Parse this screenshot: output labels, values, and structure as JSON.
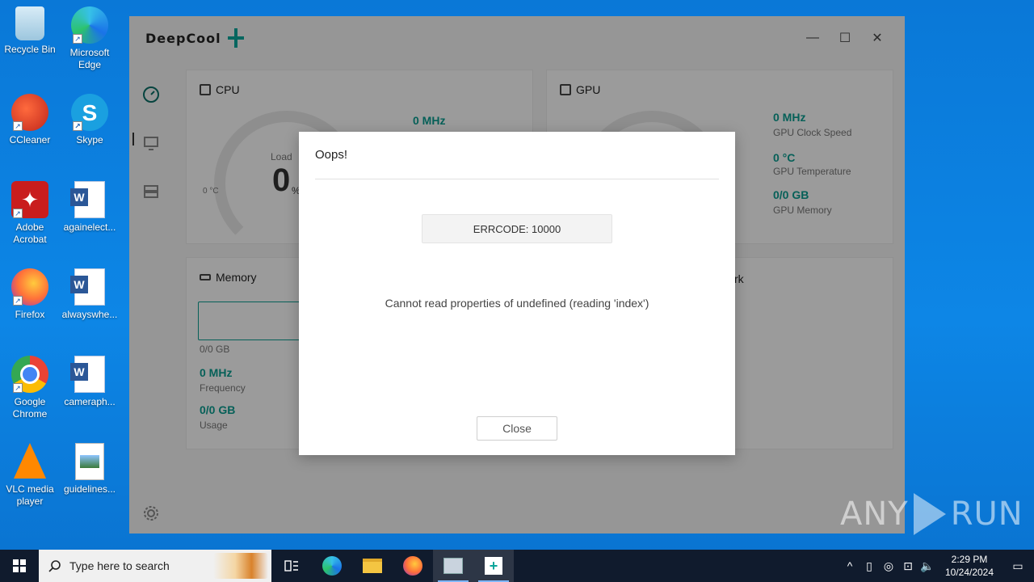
{
  "desktop": {
    "icons": [
      {
        "label": "Recycle Bin"
      },
      {
        "label": "Microsoft Edge"
      },
      {
        "label": "CCleaner"
      },
      {
        "label": "Skype"
      },
      {
        "label": "Adobe Acrobat"
      },
      {
        "label": "againelect..."
      },
      {
        "label": "Firefox"
      },
      {
        "label": "alwayswhe..."
      },
      {
        "label": "Google Chrome"
      },
      {
        "label": "cameraph..."
      },
      {
        "label": "VLC media player"
      },
      {
        "label": "guidelines..."
      }
    ]
  },
  "app": {
    "brand": "DeepCool",
    "window_controls": {
      "minimize": "—",
      "maximize": "☐",
      "close": "✕"
    },
    "cpu": {
      "title": "CPU",
      "temp": "0 °C",
      "load_label": "Load",
      "load_value": "0",
      "load_unit": "%",
      "clock": "0 MHz"
    },
    "gpu": {
      "title": "GPU",
      "clock_value": "0 MHz",
      "clock_label": "GPU Clock Speed",
      "temp_value": "0 °C",
      "temp_label": "GPU Temperature",
      "mem_value": "0/0 GB",
      "mem_label": "GPU Memory"
    },
    "memory": {
      "title": "Memory",
      "bar_label": "0/0 GB",
      "freq_value": "0 MHz",
      "freq_label": "Frequency",
      "usage_value": "0/0 GB",
      "usage_label": "Usage"
    },
    "network": {
      "title_partial": "rk"
    }
  },
  "dialog": {
    "title": "Oops!",
    "error_code": "ERRCODE: 10000",
    "message": "Cannot read properties of undefined (reading 'index')",
    "close_label": "Close"
  },
  "watermark": {
    "left": "ANY",
    "right": "RUN"
  },
  "taskbar": {
    "search_placeholder": "Type here to search",
    "time": "2:29 PM",
    "date": "10/24/2024"
  },
  "colors": {
    "accent": "#0a9b8f",
    "desktop": "#0a78d7",
    "taskbar": "#101b2d"
  }
}
